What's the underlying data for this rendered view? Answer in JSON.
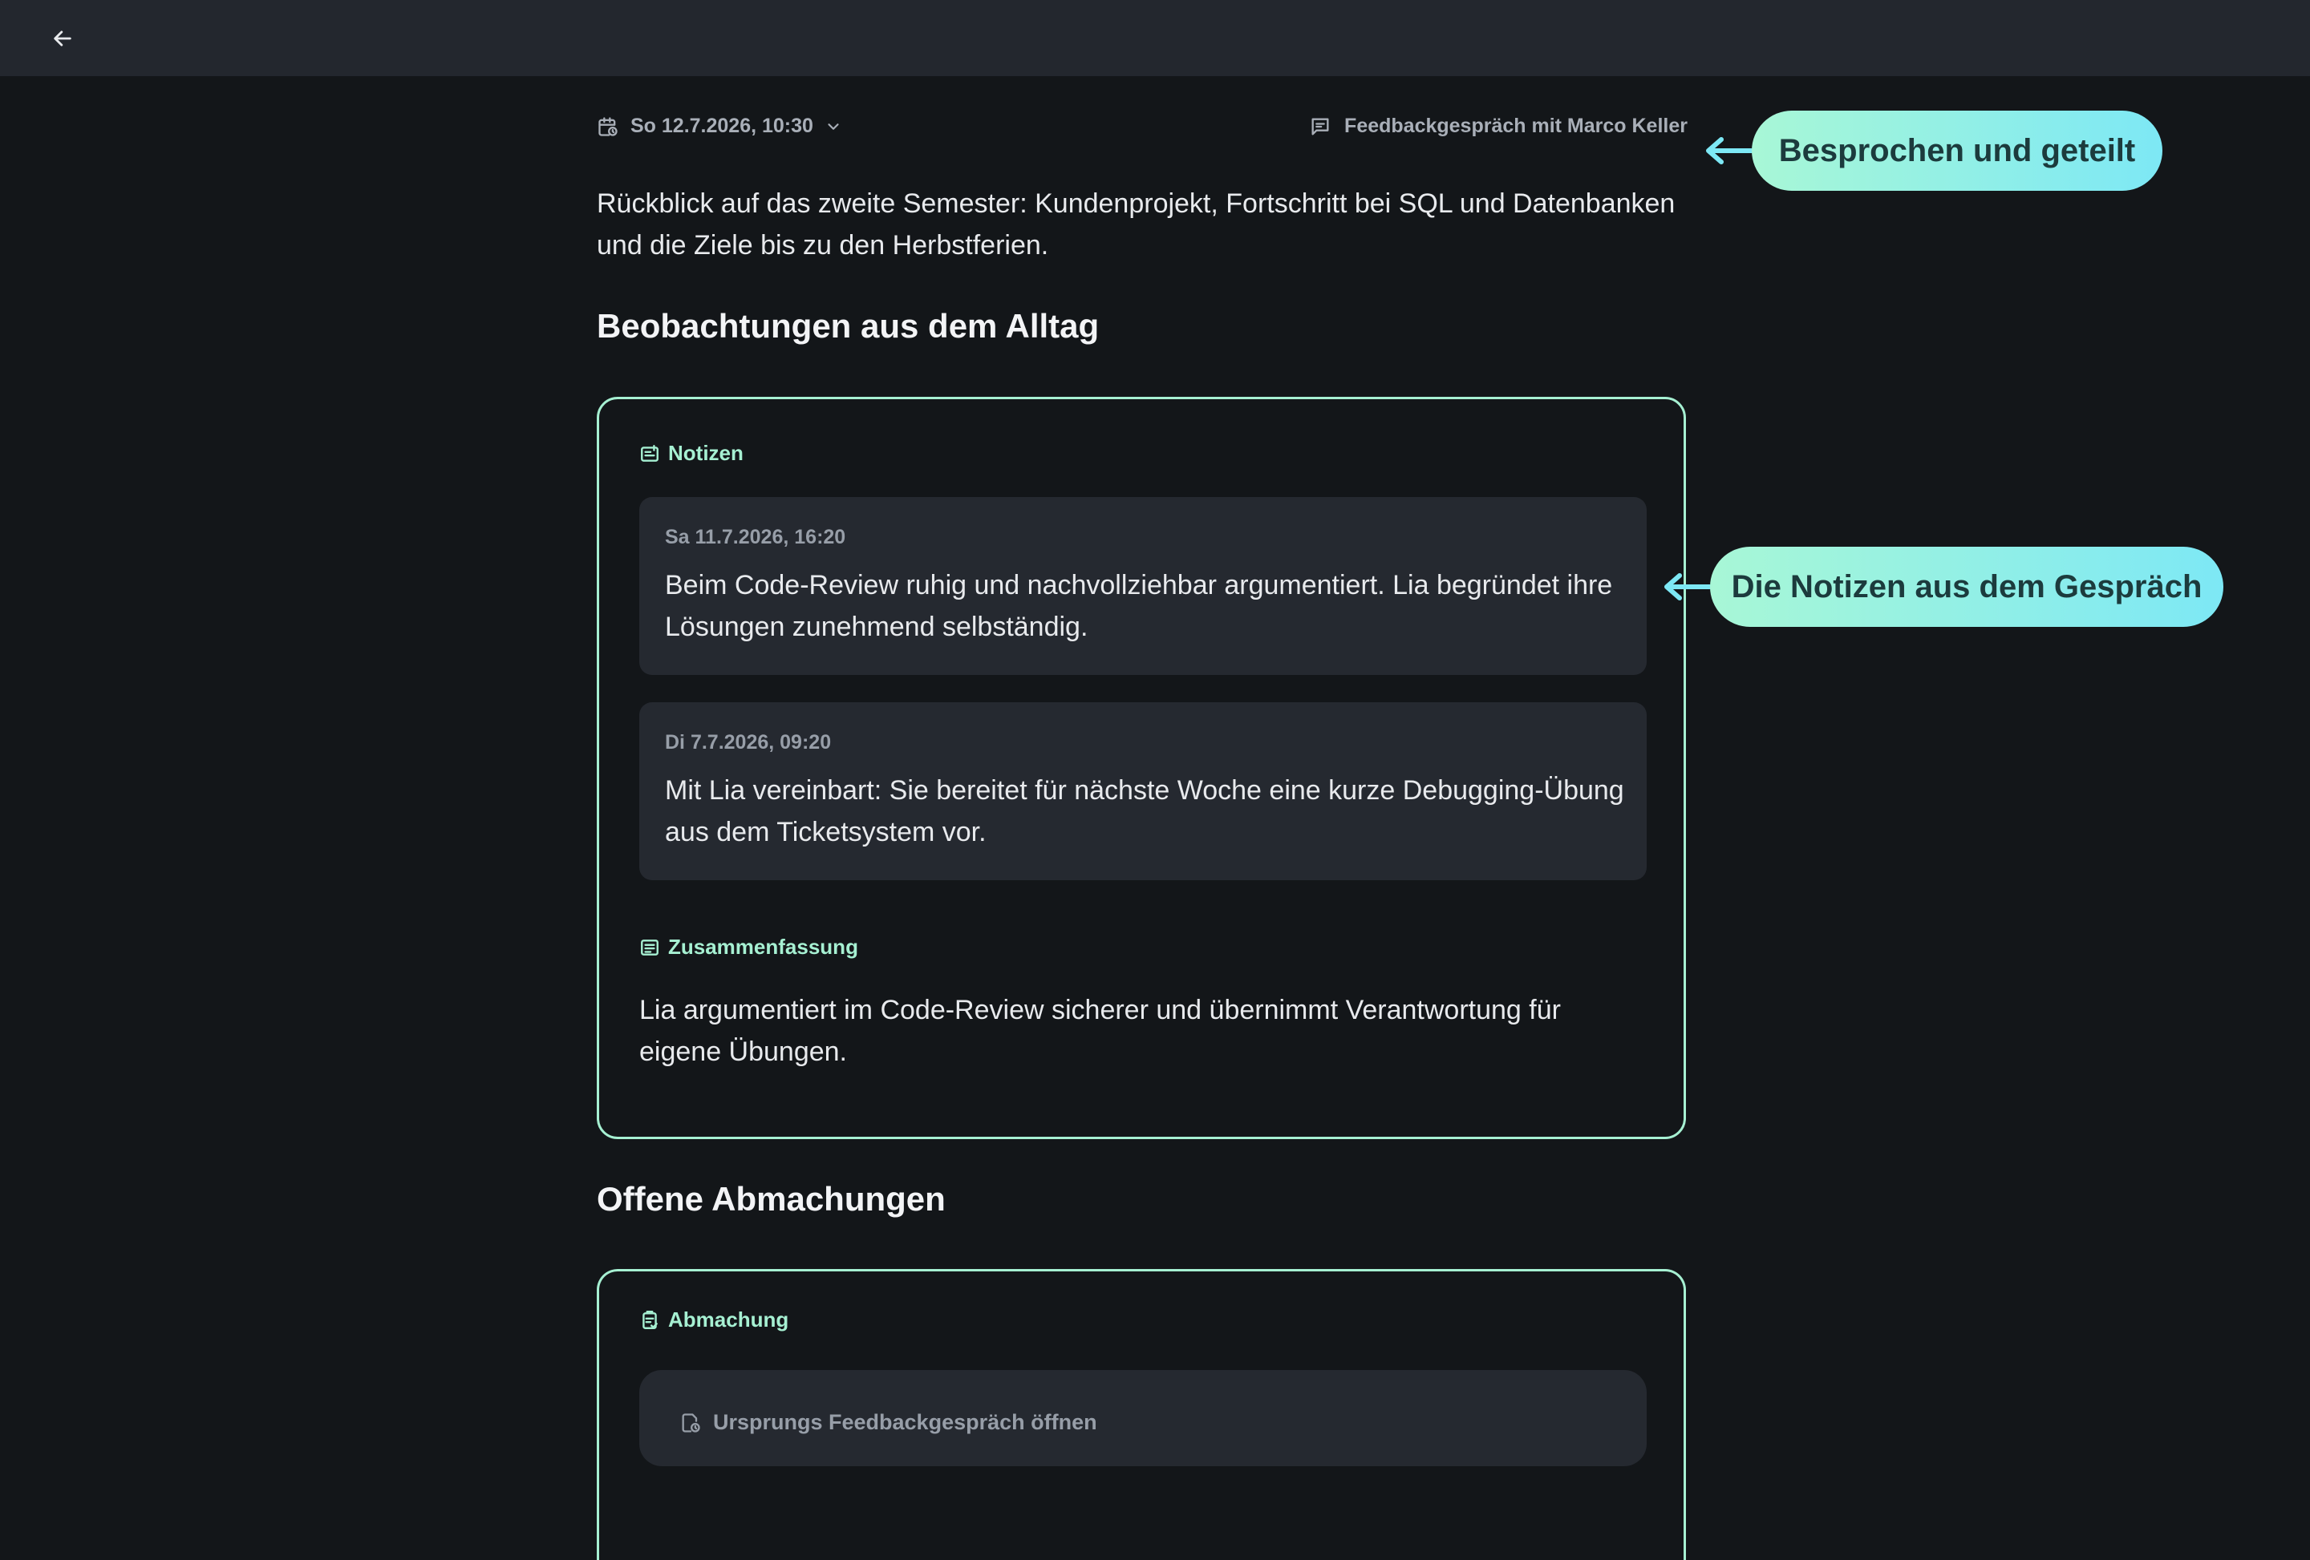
{
  "meta": {
    "date": "So 12.7.2026, 10:30",
    "conversation": "Feedbackgespräch mit Marco Keller"
  },
  "intro": "Rückblick auf das zweite Semester: Kundenprojekt, Fortschritt bei SQL und Datenbanken und die Ziele bis zu den Herbstferien.",
  "observations": {
    "title": "Beobachtungen aus dem Alltag",
    "notes_label": "Notizen",
    "notes": [
      {
        "date": "Sa 11.7.2026, 16:20",
        "text": "Beim Code-Review ruhig und nachvollziehbar argumentiert. Lia begründet ihre Lösungen zunehmend selbständig."
      },
      {
        "date": "Di 7.7.2026, 09:20",
        "text": "Mit Lia vereinbart: Sie bereitet für nächste Woche eine kurze Debugging-Übung aus dem Ticketsystem vor."
      }
    ],
    "summary_label": "Zusammenfassung",
    "summary": "Lia argumentiert im Code-Review sicherer und übernimmt Verantwortung für eigene Übungen."
  },
  "agreements": {
    "title": "Offene Abmachungen",
    "label": "Abmachung",
    "origin_link": "Ursprungs Feedbackgespräch öffnen"
  },
  "callouts": {
    "shared": "Besprochen und geteilt",
    "notes": "Die Notizen aus dem Gespräch"
  },
  "colors": {
    "background": "#131619",
    "topbar": "#23272e",
    "accent": "#a6f0d2",
    "callout_start": "#a8f7d6",
    "callout_end": "#7de8f5"
  },
  "icons": [
    "back-arrow-icon",
    "calendar-clock-icon",
    "chevron-down-icon",
    "chat-icon",
    "note-icon",
    "summary-icon",
    "agreement-icon"
  ]
}
